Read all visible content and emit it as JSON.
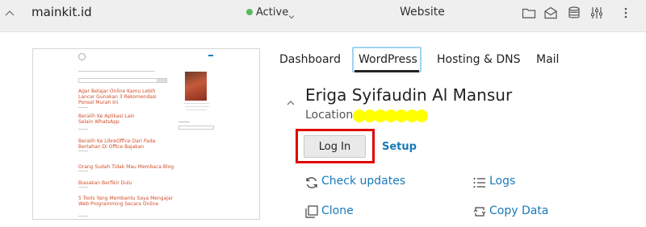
{
  "header": {
    "domain": "mainkit.id",
    "status": "Active",
    "site_type": "Website",
    "tools": [
      "folder-icon",
      "mail-icon",
      "database-icon",
      "sliders-icon",
      "more-icon"
    ],
    "status_color": "#5cb85c"
  },
  "preview": {
    "posts": [
      "Agar Belajar Online Kamu Lebih Lancar Gunakan 3 Rekomendasi Ponsel Murah Ini",
      "Beralih Ke Aplikasi Lain Selain WhatsApp",
      "Beralih Ke LibreOffice Dari Pada Bertahan Di Office Bajakan",
      "Orang Sudah Tidak Mau Membaca Blog",
      "Biasakan Berfikir Dulu",
      "5 Tools Yang Membantu Saya Mengajar Web Programming Secara Online"
    ]
  },
  "tabs": [
    "Dashboard",
    "WordPress",
    "Hosting & DNS",
    "Mail"
  ],
  "active_tab": "WordPress",
  "site": {
    "owner": "Eriga Syifaudin Al Mansur",
    "location_label": "Location:",
    "login_label": "Log In",
    "setup_label": "Setup"
  },
  "actions": {
    "check_updates": "Check updates",
    "logs": "Logs",
    "clone": "Clone",
    "copy_data": "Copy Data"
  },
  "colors": {
    "link": "#1a7ab8",
    "highlight_border": "#e00000",
    "redaction": "#ffff00",
    "tab_focus": "#9fd3f0"
  }
}
